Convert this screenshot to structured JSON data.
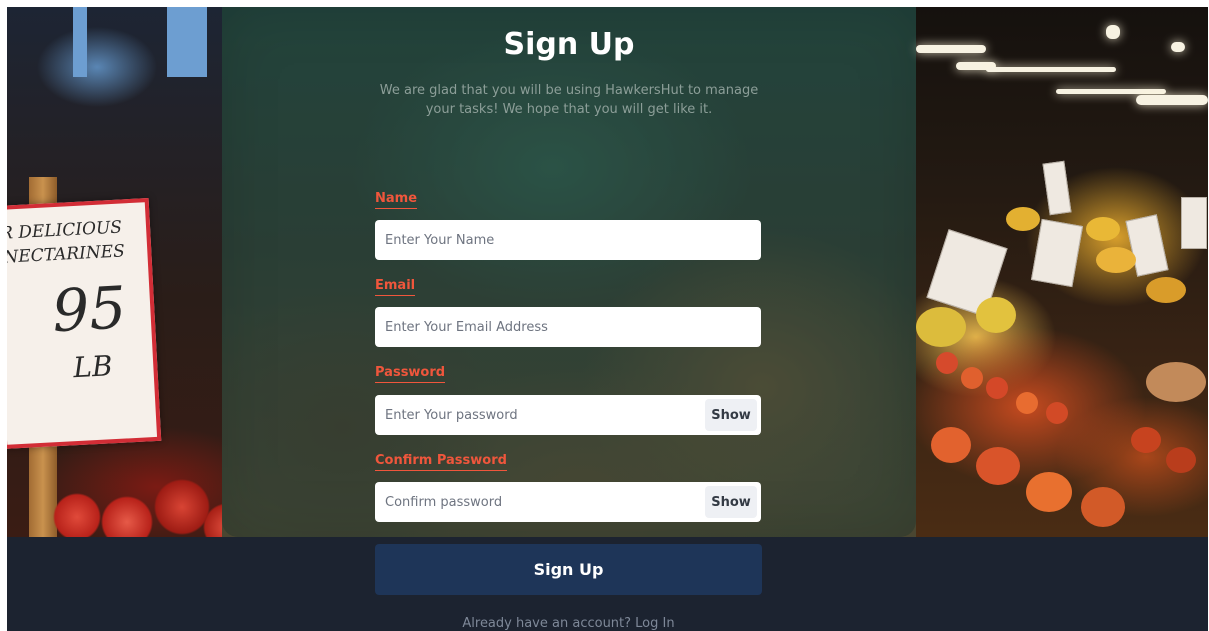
{
  "form": {
    "title": "Sign Up",
    "subtitle": "We are glad that you will be using HawkersHut to manage your tasks! We hope that you will get like it.",
    "fields": {
      "name": {
        "label": "Name",
        "placeholder": "Enter Your Name"
      },
      "email": {
        "label": "Email",
        "placeholder": "Enter Your Email Address"
      },
      "password": {
        "label": "Password",
        "placeholder": "Enter Your password",
        "toggle_label": "Show"
      },
      "confirm_password": {
        "label": "Confirm Password",
        "placeholder": "Confirm password",
        "toggle_label": "Show"
      }
    },
    "submit_label": "Sign Up",
    "login_prompt": "Already have an account? Log In"
  },
  "background": {
    "sign_line1": "R DELICIOUS",
    "sign_line2": "NECTARINES",
    "sign_price": "95",
    "sign_unit": "LB"
  },
  "colors": {
    "label_accent": "#f0563c",
    "button_primary": "#1e3558",
    "footer_background": "#1c2330"
  }
}
